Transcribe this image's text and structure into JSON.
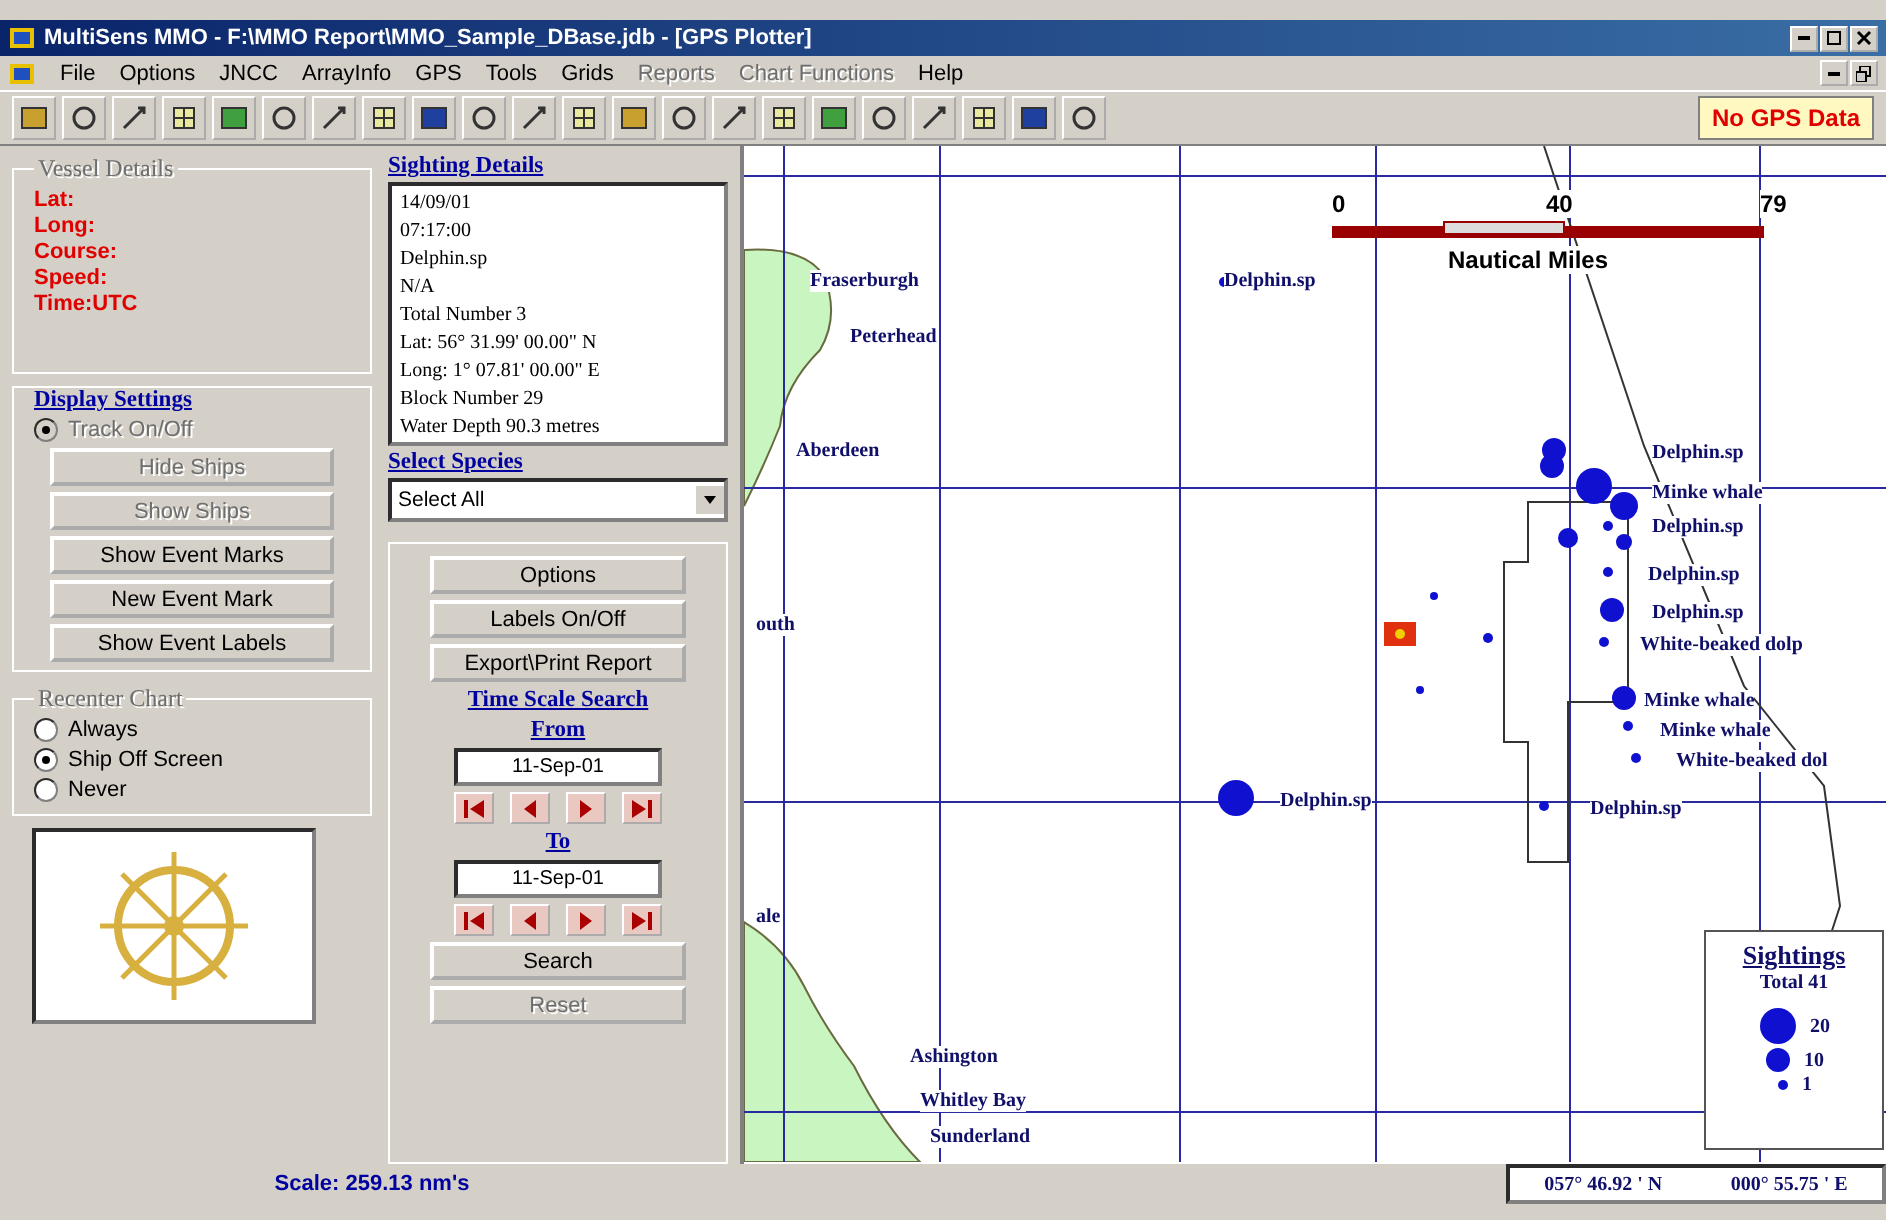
{
  "window": {
    "title": "MultiSens MMO - F:\\MMO Report\\MMO_Sample_DBase.jdb - [GPS Plotter]"
  },
  "menu": [
    {
      "label": "File",
      "disabled": false
    },
    {
      "label": "Options",
      "disabled": false
    },
    {
      "label": "JNCC",
      "disabled": false
    },
    {
      "label": "ArrayInfo",
      "disabled": false
    },
    {
      "label": "GPS",
      "disabled": false
    },
    {
      "label": "Tools",
      "disabled": false
    },
    {
      "label": "Grids",
      "disabled": false
    },
    {
      "label": "Reports",
      "disabled": true
    },
    {
      "label": "Chart Functions",
      "disabled": true
    },
    {
      "label": "Help",
      "disabled": false
    }
  ],
  "toolbar": {
    "gps_status": "No GPS Data"
  },
  "vessel_details": {
    "title": "Vessel Details",
    "fields": [
      "Lat:",
      "Long:",
      "Course:",
      "Speed:",
      "Time:UTC"
    ]
  },
  "display_settings": {
    "title": "Display Settings",
    "track_toggle": {
      "label": "Track On/Off",
      "selected": true,
      "disabled": true
    },
    "buttons": [
      {
        "label": "Hide Ships",
        "disabled": true
      },
      {
        "label": "Show Ships",
        "disabled": true
      },
      {
        "label": "Show Event Marks",
        "disabled": false
      },
      {
        "label": "New Event Mark",
        "disabled": false
      },
      {
        "label": "Show Event Labels",
        "disabled": false
      }
    ]
  },
  "recenter_chart": {
    "title": "Recenter Chart",
    "options": [
      {
        "label": "Always",
        "selected": false
      },
      {
        "label": "Ship Off Screen",
        "selected": true
      },
      {
        "label": "Never",
        "selected": false
      }
    ]
  },
  "sighting_details": {
    "title": "Sighting Details",
    "lines": [
      "14/09/01",
      "07:17:00",
      "Delphin.sp",
      "N/A",
      "Total Number  3",
      "Lat:  56° 31.99' 00.00\" N",
      "Long:  1° 07.81' 00.00\" E",
      "Block Number  29",
      "Water Depth  90.3  metres"
    ]
  },
  "select_species": {
    "title": "Select Species",
    "value": "Select All"
  },
  "actions": [
    {
      "label": "Options",
      "disabled": false
    },
    {
      "label": "Labels On/Off",
      "disabled": false
    },
    {
      "label": "Export\\Print Report",
      "disabled": false
    }
  ],
  "time_scale_search": {
    "title": "Time Scale Search",
    "from_label": "From",
    "from_value": "11-Sep-01",
    "to_label": "To",
    "to_value": "11-Sep-01",
    "search": {
      "label": "Search",
      "disabled": false
    },
    "reset": {
      "label": "Reset",
      "disabled": true
    }
  },
  "scale": "Scale: 259.13 nm's",
  "map": {
    "scale_bar": {
      "ticks": [
        "0",
        "40",
        "79"
      ],
      "unit": "Nautical Miles"
    },
    "places": [
      "Fraserburgh",
      "Peterhead",
      "Aberdeen",
      "outh",
      "ale",
      "Ashington",
      "Whitley Bay",
      "Sunderland"
    ],
    "sightings": [
      {
        "label": "Delphin.sp",
        "kind": "small"
      },
      {
        "label": "Delphin.sp",
        "kind": "medium"
      },
      {
        "label": "Minke whale",
        "kind": "large"
      },
      {
        "label": "Delphin.sp",
        "kind": "small"
      },
      {
        "label": "Delphin.sp",
        "kind": "small"
      },
      {
        "label": "Delphin.sp",
        "kind": "medium"
      },
      {
        "label": "White-beaked dolp",
        "kind": "small"
      },
      {
        "label": "Minke whale",
        "kind": "medium"
      },
      {
        "label": "Minke whale",
        "kind": "small"
      },
      {
        "label": "White-beaked dol",
        "kind": "small"
      },
      {
        "label": "Delphin.sp",
        "kind": "large"
      },
      {
        "label": "Delphin.sp",
        "kind": "small"
      }
    ],
    "legend": {
      "title": "Sightings",
      "total": "Total 41",
      "entries": [
        {
          "kind": "large",
          "count": "20"
        },
        {
          "kind": "medium",
          "count": "10"
        },
        {
          "kind": "small",
          "count": "1"
        }
      ]
    }
  },
  "status": {
    "latitude": "057° 46.92 ' N",
    "longitude": "000° 55.75 ' E"
  }
}
